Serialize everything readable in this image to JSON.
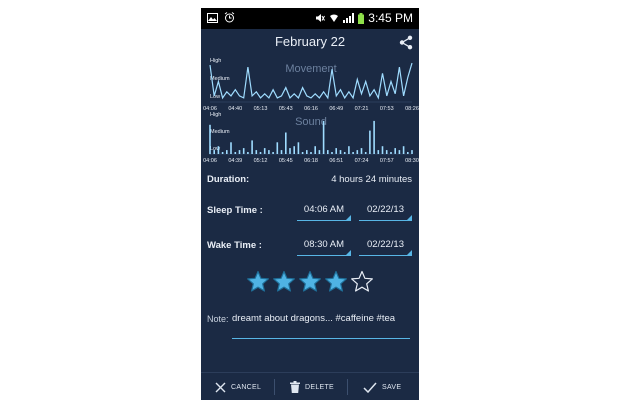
{
  "status_bar": {
    "time": "3:45 PM"
  },
  "header": {
    "title": "February 22"
  },
  "movement_chart": {
    "title": "Movement",
    "y_labels": [
      "High",
      "Medium",
      "Low"
    ],
    "x_labels": [
      "04:06",
      "04:40",
      "05:13",
      "05:43",
      "06:16",
      "06:49",
      "07:21",
      "07:53",
      "08:26"
    ]
  },
  "sound_chart": {
    "title": "Sound",
    "y_labels": [
      "High",
      "Medium",
      "Low"
    ],
    "x_labels": [
      "04:06",
      "04:39",
      "05:12",
      "05:45",
      "06:18",
      "06:51",
      "07:24",
      "07:57",
      "08:30"
    ]
  },
  "chart_data": [
    {
      "type": "line",
      "title": "Movement",
      "x": [
        "04:06",
        "04:40",
        "05:13",
        "05:43",
        "06:16",
        "06:49",
        "07:21",
        "07:53",
        "08:26"
      ],
      "y_levels": [
        "Low",
        "Medium",
        "High"
      ],
      "series": [
        {
          "values": [
            0.9,
            0.15,
            0.5,
            0.1,
            0.25,
            0.15,
            0.3,
            0.15,
            0.1,
            0.85,
            0.15,
            0.25,
            0.1,
            0.2,
            0.1,
            0.3,
            0.1,
            0.15,
            0.35,
            0.1,
            0.2,
            0.1,
            0.35,
            0.15,
            0.1,
            0.2,
            0.1,
            0.25,
            0.1,
            0.8,
            0.15,
            0.3,
            0.1,
            0.25,
            0.1,
            0.55,
            0.2,
            0.5,
            0.15,
            0.3,
            0.1,
            0.7,
            0.15,
            0.5,
            0.2,
            0.85,
            0.15,
            0.6,
            0.95
          ]
        }
      ]
    },
    {
      "type": "bar",
      "title": "Sound",
      "x": [
        "04:06",
        "04:39",
        "05:12",
        "05:45",
        "06:18",
        "06:51",
        "07:24",
        "07:57",
        "08:30"
      ],
      "y_levels": [
        "Low",
        "Medium",
        "High"
      ],
      "series": [
        {
          "values": [
            0.75,
            0.1,
            0.2,
            0.05,
            0.1,
            0.3,
            0.05,
            0.1,
            0.15,
            0.05,
            0.35,
            0.1,
            0.05,
            0.15,
            0.1,
            0.05,
            0.3,
            0.1,
            0.55,
            0.15,
            0.2,
            0.3,
            0.05,
            0.1,
            0.05,
            0.2,
            0.1,
            0.85,
            0.1,
            0.05,
            0.15,
            0.1,
            0.05,
            0.2,
            0.05,
            0.1,
            0.15,
            0.05,
            0.6,
            0.85,
            0.1,
            0.2,
            0.1,
            0.05,
            0.15,
            0.1,
            0.2,
            0.05,
            0.1
          ]
        }
      ]
    }
  ],
  "duration": {
    "label": "Duration:",
    "value": "4 hours 24 minutes"
  },
  "sleep_time": {
    "label": "Sleep Time :",
    "time": "04:06 AM",
    "date": "02/22/13"
  },
  "wake_time": {
    "label": "Wake Time :",
    "time": "08:30 AM",
    "date": "02/22/13"
  },
  "rating": {
    "value": 4,
    "max": 5
  },
  "note": {
    "label": "Note:",
    "text": "dreamt about dragons... #caffeine #tea"
  },
  "actions": {
    "cancel": "CANCEL",
    "delete": "DELETE",
    "save": "SAVE"
  },
  "colors": {
    "background": "#1b2a44",
    "accent": "#58b6e6",
    "chart_line": "#9fdcff",
    "star_fill": "#4fb3e4"
  },
  "icons": {
    "share": "share-icon",
    "cancel": "close-icon",
    "delete": "trash-icon",
    "save": "check-icon"
  }
}
